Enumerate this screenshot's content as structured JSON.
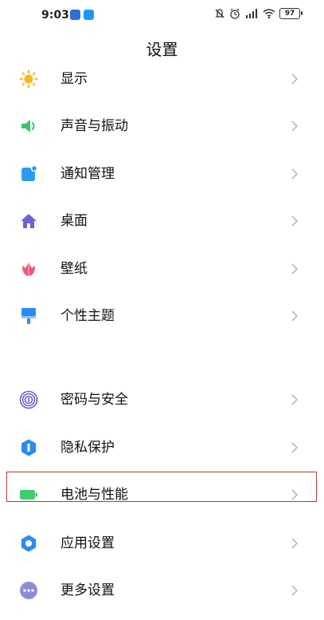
{
  "status_bar": {
    "time": "9:03",
    "battery": "97",
    "icons": [
      "app-badge-icon",
      "app-badge-icon",
      "mute-icon",
      "alarm-icon",
      "hd-signal-icon",
      "wifi-icon",
      "battery-icon"
    ]
  },
  "header": {
    "title": "设置"
  },
  "settings": {
    "group1": [
      {
        "label": "显示",
        "icon": "sun-icon",
        "color": "#f6b81f"
      },
      {
        "label": "声音与振动",
        "icon": "speaker-icon",
        "color": "#3cc56a"
      },
      {
        "label": "通知管理",
        "icon": "notification-icon",
        "color": "#2b9cf0"
      },
      {
        "label": "桌面",
        "icon": "home-icon",
        "color": "#6c63d8"
      },
      {
        "label": "壁纸",
        "icon": "tulip-icon",
        "color": "#f0577c"
      },
      {
        "label": "个性主题",
        "icon": "paintbrush-icon",
        "color": "#2b8cf0"
      }
    ],
    "group2": [
      {
        "label": "密码与安全",
        "icon": "fingerprint-icon",
        "color": "#6b5fd0"
      },
      {
        "label": "隐私保护",
        "icon": "privacy-shield-icon",
        "color": "#2b8cf0"
      },
      {
        "label": "电池与性能",
        "icon": "battery-icon",
        "color": "#3ccf6e"
      },
      {
        "label": "应用设置",
        "icon": "gear-icon",
        "color": "#2b8cf0"
      },
      {
        "label": "更多设置",
        "icon": "more-icon",
        "color": "#8c8fd6"
      }
    ]
  },
  "colors": {
    "highlight": "#b3382f",
    "chevron": "#b0b0b0"
  }
}
